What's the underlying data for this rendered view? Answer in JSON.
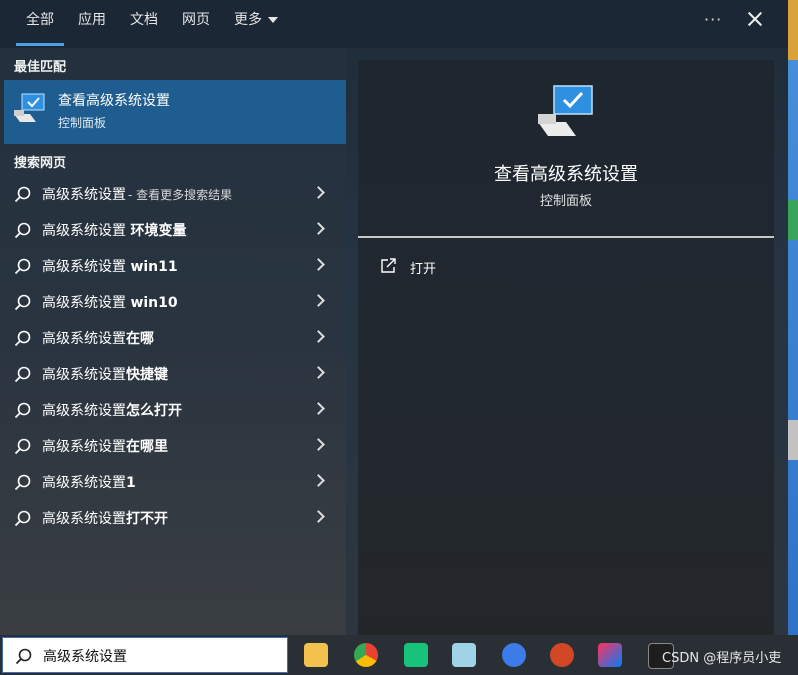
{
  "tabs": [
    {
      "label": "全部",
      "active": true
    },
    {
      "label": "应用"
    },
    {
      "label": "文档"
    },
    {
      "label": "网页"
    },
    {
      "label": "更多"
    }
  ],
  "header": {
    "more_options": "···"
  },
  "best_match": {
    "section_title": "最佳匹配",
    "title": "查看高级系统设置",
    "subtitle": "控制面板"
  },
  "web_search": {
    "section_title": "搜索网页",
    "results": [
      {
        "text": "高级系统设置",
        "hint": "- 查看更多搜索结果"
      },
      {
        "text": "高级系统设置 ",
        "bold": "环境变量"
      },
      {
        "text": "高级系统设置 ",
        "bold": "win11"
      },
      {
        "text": "高级系统设置 ",
        "bold": "win10"
      },
      {
        "text": "高级系统设置",
        "bold": "在哪"
      },
      {
        "text": "高级系统设置",
        "bold": "快捷键"
      },
      {
        "text": "高级系统设置",
        "bold": "怎么打开"
      },
      {
        "text": "高级系统设置",
        "bold": "在哪里"
      },
      {
        "text": "高级系统设置",
        "bold": "1"
      },
      {
        "text": "高级系统设置",
        "bold": "打不开"
      }
    ]
  },
  "detail": {
    "title": "查看高级系统设置",
    "subtitle": "控制面板",
    "actions": [
      {
        "label": "打开"
      }
    ]
  },
  "taskbar": {
    "search_value": "高级系统设置",
    "apps": [
      {
        "name": "file-explorer-icon",
        "color": "#f2c14e"
      },
      {
        "name": "chrome-icon",
        "color": "#e94235"
      },
      {
        "name": "mindmaster-icon",
        "color": "#19c27a"
      },
      {
        "name": "notes-app-icon",
        "color": "#9fd3e8"
      },
      {
        "name": "browser-app-icon",
        "color": "#3c7be8"
      },
      {
        "name": "powerpoint-icon",
        "color": "#d24726"
      },
      {
        "name": "intellij-idea-icon",
        "color": "#fe315d"
      },
      {
        "name": "terminal-icon",
        "color": "#1e1e1e"
      }
    ],
    "watermark": "CSDN @程序员小吏"
  },
  "colors": {
    "accent": "#4ca0e8",
    "selected": "#1f5c8f"
  }
}
